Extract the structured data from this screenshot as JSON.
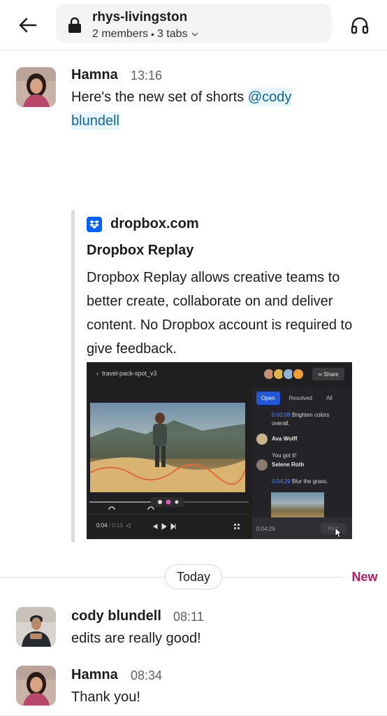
{
  "header": {
    "channel_name": "rhys-livingston",
    "members": "2 members",
    "tabs": "3 tabs"
  },
  "messages": [
    {
      "author": "Hamna",
      "time": "13:16",
      "text_before": "Here's the new set of shorts",
      "mention_line1": "@cody",
      "mention_line2": "blundell"
    },
    {
      "author": "cody blundell",
      "time": "08:11",
      "text": "edits are really good!"
    },
    {
      "author": "Hamna",
      "time": "08:34",
      "text": "Thank you!"
    }
  ],
  "unfurl": {
    "site": "dropbox.com",
    "title": "Dropbox Replay",
    "description": "Dropbox Replay allows creative teams to better create, collaborate on and deliver content. No Dropbox account is required to give feedback.",
    "preview": {
      "file": "travel-pack-spot_v3",
      "share": "Share",
      "tabs": [
        "Open",
        "Resolved",
        "All"
      ],
      "comments": [
        {
          "ts": "0:03:08",
          "text": "Brighten colors overall."
        },
        {
          "name": "Ava Wolff",
          "text": "You got it!"
        },
        {
          "name": "Selene Roth",
          "ts": "0:04:29",
          "text": "Blur the grass."
        }
      ],
      "current_time": "0:04",
      "duration": "0:13",
      "input_time": "0:04:29",
      "post": "Post"
    }
  },
  "divider": {
    "today": "Today",
    "new": "New"
  },
  "colors": {
    "mention_bg": "#e8f5fa",
    "mention_text": "#1264a3",
    "new": "#c3185a",
    "dropbox": "#0061fe"
  }
}
